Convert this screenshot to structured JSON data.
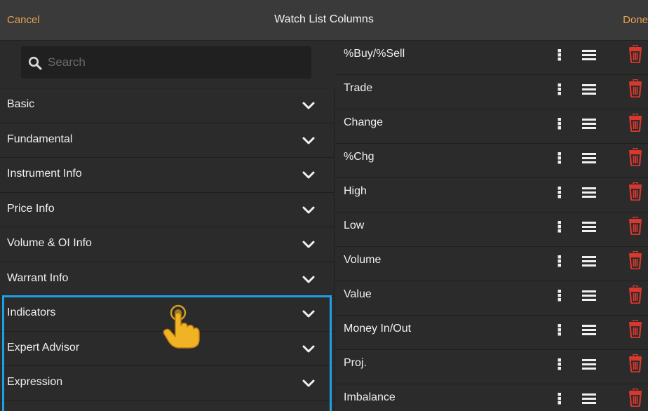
{
  "header": {
    "cancel_label": "Cancel",
    "title": "Watch List Columns",
    "done_label": "Done"
  },
  "search": {
    "placeholder": "Search",
    "value": ""
  },
  "categories": [
    {
      "label": "Basic"
    },
    {
      "label": "Fundamental"
    },
    {
      "label": "Instrument Info"
    },
    {
      "label": "Price Info"
    },
    {
      "label": "Volume & OI Info"
    },
    {
      "label": "Warrant Info"
    },
    {
      "label": "Indicators"
    },
    {
      "label": "Expert Advisor"
    },
    {
      "label": "Expression"
    }
  ],
  "columns": [
    {
      "label": "%Buy/%Sell"
    },
    {
      "label": "Trade"
    },
    {
      "label": "Change"
    },
    {
      "label": "%Chg"
    },
    {
      "label": "High"
    },
    {
      "label": "Low"
    },
    {
      "label": "Volume"
    },
    {
      "label": "Value"
    },
    {
      "label": "Money In/Out"
    },
    {
      "label": "Proj."
    },
    {
      "label": "Imbalance"
    }
  ],
  "colors": {
    "accent": "#e8a24e",
    "highlight": "#1ea0e6",
    "delete": "#d9382e",
    "pointer_hand": "#f0b323"
  },
  "icons": {
    "search": "search-icon",
    "expand": "chevron-down-icon",
    "options": "kebab-icon",
    "reorder": "drag-handle-icon",
    "delete": "trash-icon",
    "pointer": "pointer-hand-icon"
  }
}
